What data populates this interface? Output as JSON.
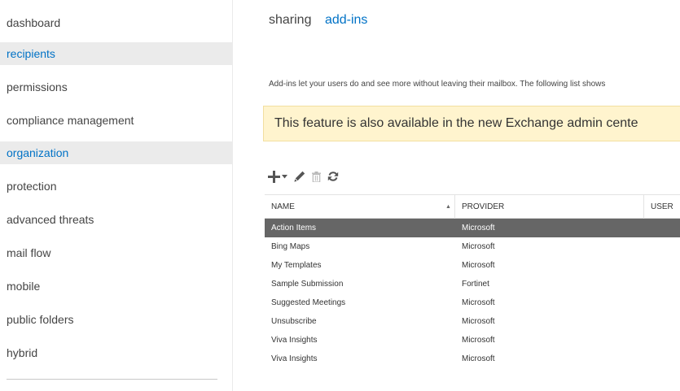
{
  "nav": {
    "items": [
      {
        "label": "dashboard",
        "active": false
      },
      {
        "label": "recipients",
        "active": true
      },
      {
        "label": "permissions",
        "active": false
      },
      {
        "label": "compliance management",
        "active": false
      },
      {
        "label": "organization",
        "active": true
      },
      {
        "label": "protection",
        "active": false
      },
      {
        "label": "advanced threats",
        "active": false
      },
      {
        "label": "mail flow",
        "active": false
      },
      {
        "label": "mobile",
        "active": false
      },
      {
        "label": "public folders",
        "active": false
      },
      {
        "label": "hybrid",
        "active": false
      }
    ]
  },
  "tabs": [
    {
      "label": "sharing",
      "active": false
    },
    {
      "label": "add-ins",
      "active": true
    }
  ],
  "description": "Add-ins let your users do and see more without leaving their mailbox. The following list shows",
  "banner": {
    "text": "This feature is also available in the new Exchange admin cente"
  },
  "toolbar": {
    "icons": [
      "add-icon",
      "dropdown-arrow-icon",
      "edit-icon",
      "delete-icon",
      "refresh-icon"
    ]
  },
  "table": {
    "columns": [
      "NAME",
      "PROVIDER",
      "USER"
    ],
    "sorted_column": "NAME",
    "sort_direction": "ascending",
    "rows": [
      {
        "name": "Action Items",
        "provider": "Microsoft",
        "selected": true
      },
      {
        "name": "Bing Maps",
        "provider": "Microsoft",
        "selected": false
      },
      {
        "name": "My Templates",
        "provider": "Microsoft",
        "selected": false
      },
      {
        "name": "Sample Submission",
        "provider": "Fortinet",
        "selected": false
      },
      {
        "name": "Suggested Meetings",
        "provider": "Microsoft",
        "selected": false
      },
      {
        "name": "Unsubscribe",
        "provider": "Microsoft",
        "selected": false
      },
      {
        "name": "Viva Insights",
        "provider": "Microsoft",
        "selected": false
      },
      {
        "name": "Viva Insights",
        "provider": "Microsoft",
        "selected": false
      }
    ]
  },
  "colors": {
    "accent": "#0072c6",
    "selected_row": "#666666",
    "banner_bg": "#fff4ce",
    "nav_active_bg": "#ebebeb"
  }
}
